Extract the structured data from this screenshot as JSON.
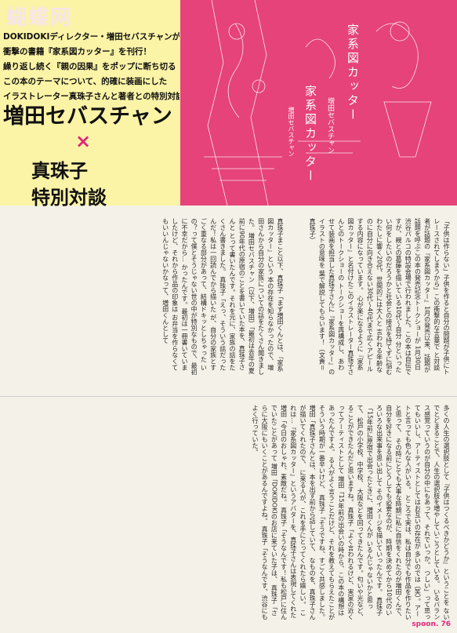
{
  "header": {
    "watermark": "蝴蝶网",
    "lead_lines": [
      "DOKIDOKIディレクター・増田セバスチャンが、",
      "衝撃の書籍『家系図カッター』を刊行！",
      "繰り返し続く『親の因果』をポップに断ち切る",
      "この本のテーマについて、的確に装画にした",
      "イラストレーター真珠子さんと著者との特別対談を掲載！"
    ],
    "title_line1": "増田セバスチャン",
    "title_cross": "×",
    "title_line2": "真珠子",
    "title_line3": "特別対談"
  },
  "photo": {
    "book_title_a": "家系図カッター",
    "author_a": "増田セバスチャン",
    "book_title_b": "家系図カッター",
    "author_b": "増田セバスチャン"
  },
  "columns_top": [
    "「子供は作らない」子供を作ると自分の問題が子供にトレースされてしまうから」この衝撃的な言葉で",
    "と対談者が話題の『家系図カッター』1月の発売以来、話題が話題を呼ぶこの本の発売記念トークショーが",
    "1月30日渋谷パルコの特設会場で行われました。この本は自伝ですが、親との葛藤を描いている10代〜自分",
    "分といったい何をしたいのだろうかと社会との接点を持てずに悩むわたしに響く20代、世間的には大人と",
    "言われる年齢なのに自分に向き合えない30代〜40代まで広くアピールする内容になっています。",
    "心が楽になるように『家系図カッター』と名付けたこのイラストレーター真珠子さんとのトークショーの",
    "トークショーを再構成し、あわせて装画を担当した真珠子さんに『家系図カッター』のイラストの意味を",
    "葉で解説してもらいます！（文責＝真珠子）"
  ],
  "columns_mid": [
    "真珠子まこと以下、真珠子「まず増田くんとは、『家系図カッター』という",
    "本の存在を知らなかったので、増田さんから自分の家族についての話をたくさん聞きました。",
    "増田セバスチャン（以下、増田）「最初は去年の夏前に90年代の原宿のことを書いていた本を、真珠子さんと",
    "とって書いたんです。それを元に、家族の話をたくさん書きました。",
    "真珠子「えっ、そういう話だったんだ！私は一回読んでから描いた",
    "が、自分の家族とすごく重なる部分があって、結構ドキッとしちゃった",
    "いの？って僕とそうじゃない世の中が特別なもので、最初に不幸だから…",
    "かったんです。最初は一冊書いていましたけど、それから作品の印象は",
    "お弁当を作らなくてもいいんじゃないかなって、増田くんとして"
  ],
  "columns_bot": [
    "多くの人生の選択肢として『子供はつくるべきかどうか』ということを",
    "ないでとどまることで、人生の選択肢を増やしていこうとしている。",
    "いるバランス感覚っていうのが自分の中にもあって、それでいっか。",
    "つしい」って思ってもいいし、アーティストとしてはお互いの存在が",
    "多いのでは（笑）。アートと言っても色んな人がいる。",
    "ところで実は、私は自分でも作品を作りたいと思って、",
    "その時にとても大事な時期に私に自信をくれたのが増田くんで、",
    "自分を好きになる前にどうしても必要なのが、",
    "時期を決めてから10代のいろいろな出来事を思い出して",
    "そのイメージを描いていったんです。",
    "真珠子「15年前に原宿で出会ったときに、増田くんが",
    "いるんじゃないかと思って、松戸の小学校、中学校、",
    "大阪などを回ってきたんです。匂いや光など、",
    "ることができたんだと思いますね。",
    "真珠子「よく言われるけど、実家の近くってアーティストとして",
    "増田「15年前の出会いの時から、この本の構想はあったんですよ。",
    "る人がよく言うことだけど、それを教えてもらえたことが",
    "そういう時期が一番辛いけど、",
    "真珠子「そうですね、すごく共感しました。",
    "増田「真珠子さんとは、本を出す前から話していて、",
    "なものを、真珠子さんが描いてくれたので、",
    "に来る人が、これを手にとってくれたら嬉しい。",
    "これは…『家系図カッター』というアバターを、真珠子さんは表現してくれた",
    "増田「今日のおしゃれ、素敵だね。",
    "真珠子「そうなんです！私も松戸に住んでいたことがあって",
    "増田「DOKIDOKIのお店に来ていた子は、",
    "真珠子「さらに大阪にもいくことがあるんですよね。",
    "真珠子「そうなんです、渋谷にもよく行っていた。"
  ],
  "footer": {
    "magazine": "spoon.",
    "page": "76"
  }
}
